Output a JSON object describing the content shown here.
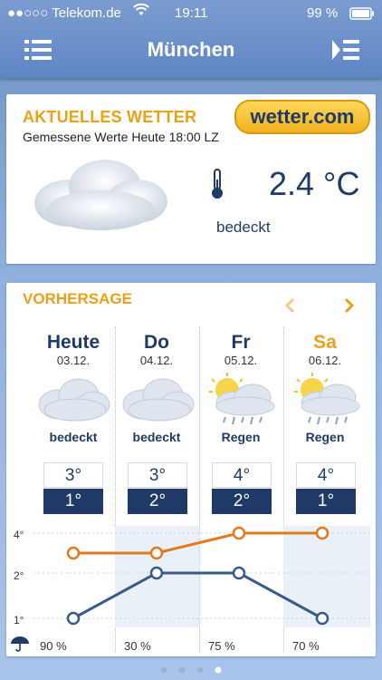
{
  "status": {
    "carrier": "●●○○○ Telekom.de",
    "time": "19:11",
    "battery": "99 %"
  },
  "header": {
    "title": "München"
  },
  "current": {
    "heading": "AKTUELLES WETTER",
    "subheading": "Gemessene Werte Heute 18:00 LZ",
    "brand": "wetter.com",
    "temperature": "2.4 °C",
    "condition": "bedeckt"
  },
  "forecast": {
    "heading": "VORHERSAGE",
    "days": [
      {
        "name": "Heute",
        "date": "03.12.",
        "condition": "bedeckt",
        "max": "3°",
        "min": "1°"
      },
      {
        "name": "Do",
        "date": "04.12.",
        "condition": "bedeckt",
        "max": "3°",
        "min": "2°"
      },
      {
        "name": "Fr",
        "date": "05.12.",
        "condition": "Regen",
        "max": "4°",
        "min": "2°"
      },
      {
        "name": "Sa",
        "date": "06.12.",
        "condition": "Regen",
        "max": "4°",
        "min": "1°"
      }
    ],
    "y_labels": [
      "4°",
      "2°",
      "1°"
    ],
    "precipitation": [
      "90 %",
      "30 %",
      "75 %",
      "70 %"
    ]
  },
  "chart_data": {
    "type": "line",
    "x": [
      "Heute",
      "Do",
      "Fr",
      "Sa"
    ],
    "series": [
      {
        "values": [
          3,
          3,
          4,
          4
        ],
        "color": "#e07a20"
      },
      {
        "values": [
          1,
          2,
          2,
          1
        ],
        "color": "#3a5a8c"
      }
    ]
  },
  "colors": {
    "accent": "#e8a21a",
    "navy": "#1f3a66",
    "header": "#6a8fcb"
  }
}
